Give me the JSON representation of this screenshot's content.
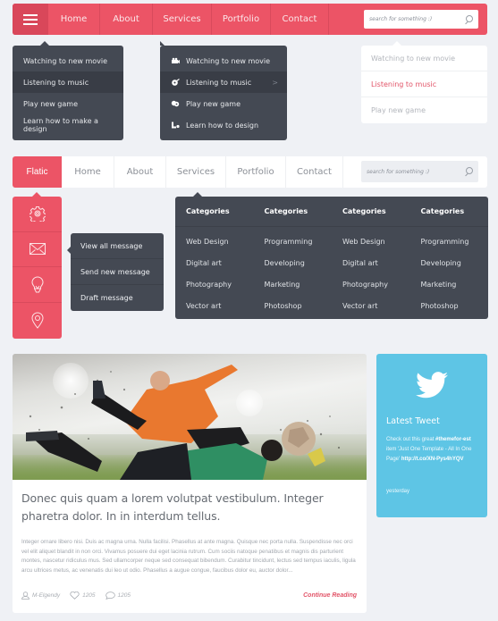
{
  "nav_primary": {
    "menu_icon": "hamburger-icon",
    "items": [
      "Home",
      "About",
      "Services",
      "Portfolio",
      "Contact"
    ],
    "search_placeholder": "search for something :)",
    "search_icon": "search-icon",
    "accent_color": "#ec5466"
  },
  "dropdown_plain": {
    "items": [
      "Watching to new movie",
      "Listening to music",
      "Play new game",
      "Learn how to make a design"
    ],
    "active_index": 1
  },
  "dropdown_icons": {
    "items": [
      {
        "label": "Watching to new movie",
        "icon": "video-camera-icon"
      },
      {
        "label": "Listening to music",
        "icon": "music-disc-icon",
        "has_submenu": true
      },
      {
        "label": "Play new game",
        "icon": "gamepad-icon"
      },
      {
        "label": "Learn how to design",
        "icon": "design-tools-icon"
      }
    ],
    "submenu_glyph": ">",
    "active_index": 1
  },
  "dropdown_light": {
    "items": [
      "Watching to new movie",
      "Listening to music",
      "Play new game"
    ],
    "active_index": 1
  },
  "nav_secondary": {
    "brand": "Flatic",
    "items": [
      "Home",
      "About",
      "Services",
      "Portfolio",
      "Contact"
    ],
    "search_placeholder": "search for something :)"
  },
  "icon_sidebar": {
    "items": [
      "gear-icon",
      "envelope-icon",
      "lightbulb-icon",
      "map-pin-icon"
    ]
  },
  "message_menu": {
    "items": [
      "View all message",
      "Send new message",
      "Draft message"
    ]
  },
  "mega_menu": {
    "columns": [
      {
        "heading": "Categories",
        "links": [
          "Web Design",
          "Digital art",
          "Photography",
          "Vector art"
        ]
      },
      {
        "heading": "Categories",
        "links": [
          "Programming",
          "Developing",
          "Marketing",
          "Photoshop"
        ]
      },
      {
        "heading": "Categories",
        "links": [
          "Web Design",
          "Digital art",
          "Photography",
          "Vector art"
        ]
      },
      {
        "heading": "Categories",
        "links": [
          "Programming",
          "Developing",
          "Marketing",
          "Photoshop"
        ]
      }
    ]
  },
  "blog_post": {
    "image_alt": "Soccer players tackling in stadium",
    "title": "Donec quis quam a lorem volutpat vestibulum. Integer pharetra dolor. In in interdum tellus.",
    "excerpt": "Integer ornare libero nisi. Duis ac magna urna. Nulla facilisi. Phasellus at ante magna. Quisque nec porta nulla. Suspendisse nec orci vel elit aliquet blandit in non orci. Vivamus posuere dui eget lacinia rutrum. Cum sociis natoque penatibus et magnis dis parturient montes, nascetur ridiculus mus. Sed ullamcorper neque sed consequat bibendum. Curabitur tincidunt, lectus sed tempus iaculis, ligula arcu ultrices metus, ac venenatis dui leo ut odio. Phasellus a augue congue, faucibus dolor eu, auctor dolor...",
    "author": "M-Elgendy",
    "likes": "1205",
    "comments": "1205",
    "read_more": "Continue Reading"
  },
  "tweet_widget": {
    "icon": "twitter-bird-icon",
    "title": "Latest Tweet",
    "text_prefix": "Check out this great ",
    "hashtag": "#themefor-est",
    "text_middle": " item 'Just One Template - All In One Page' ",
    "link": "http://t.co/XN-Pys4hYQV",
    "timestamp": "yesterday",
    "color": "#5ec5e5"
  }
}
